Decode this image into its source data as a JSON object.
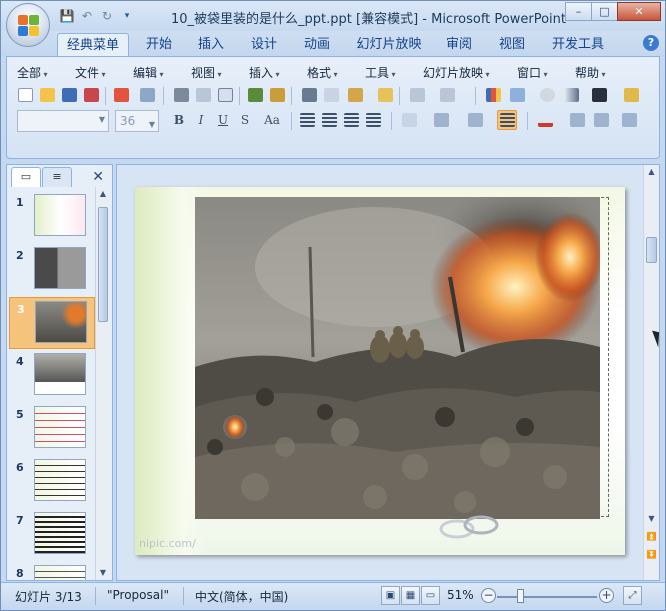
{
  "window": {
    "title": "10_被袋里装的是什么_ppt.ppt [兼容模式] - Microsoft PowerPoint",
    "controls": [
      "–",
      "□",
      "✕"
    ]
  },
  "ribbon_tabs": [
    "经典菜单",
    "开始",
    "插入",
    "设计",
    "动画",
    "幻灯片放映",
    "审阅",
    "视图",
    "开发工具"
  ],
  "active_tab": "经典菜单",
  "classic_menu": [
    "全部",
    "文件",
    "编辑",
    "视图",
    "插入",
    "格式",
    "工具",
    "幻灯片放映",
    "窗口",
    "帮助"
  ],
  "font": {
    "name_value": "",
    "size_value": "36"
  },
  "format_buttons": [
    "B",
    "I",
    "U",
    "S",
    "Aa"
  ],
  "slides_panel": {
    "tabs": [
      "slides-tab",
      "outline-tab"
    ],
    "slide_numbers": [
      "1",
      "2",
      "3",
      "4",
      "5",
      "6",
      "7",
      "8"
    ],
    "selected": "3"
  },
  "slide": {
    "watermark": "nipic.com/"
  },
  "statusbar": {
    "slide_info": "幻灯片 3/13",
    "theme": "\"Proposal\"",
    "language": "中文(简体，中国)",
    "zoom": "51%"
  },
  "colors": {
    "accent": "#3a7ad0",
    "selected_thumb": "#f5c37b",
    "ribbon_bg": "#d5e3f4"
  }
}
